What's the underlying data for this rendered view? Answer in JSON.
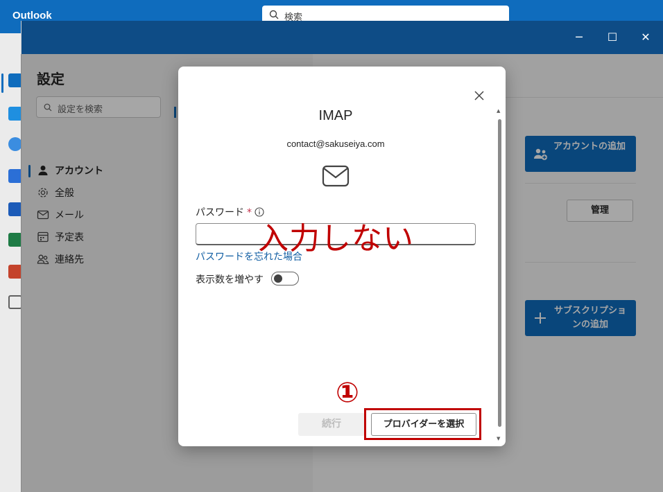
{
  "app": {
    "title": "Outlook",
    "search_placeholder": "検索"
  },
  "window": {
    "minimize": "─",
    "maximize": "☐",
    "close": "✕"
  },
  "settings": {
    "title": "設定",
    "search_placeholder": "設定を検索",
    "nav": [
      {
        "label": "アカウント",
        "icon": "person-icon",
        "active": true
      },
      {
        "label": "全般",
        "icon": "gear-icon"
      },
      {
        "label": "メール",
        "icon": "mail-icon"
      },
      {
        "label": "予定表",
        "icon": "calendar-icon"
      },
      {
        "label": "連絡先",
        "icon": "people-icon"
      }
    ],
    "add_account_label": "アカウントの追加",
    "manage_label": "管理",
    "add_subscription_label": "サブスクリプションの追加"
  },
  "dialog": {
    "title": "IMAP",
    "email": "contact@sakuseiya.com",
    "password_label": "パスワード",
    "required_mark": "*",
    "password_value": "",
    "forgot_link": "パスワードを忘れた場合",
    "show_more_label": "表示数を増やす",
    "show_more_on": false,
    "continue_label": "続行",
    "provider_label": "プロバイダーを選択"
  },
  "annotations": {
    "note": "入力しない",
    "step": "①",
    "color": "#c00000"
  },
  "colors": {
    "brand": "#0f6cbd",
    "titlebar": "#0e4c86",
    "link": "#115ea3"
  }
}
